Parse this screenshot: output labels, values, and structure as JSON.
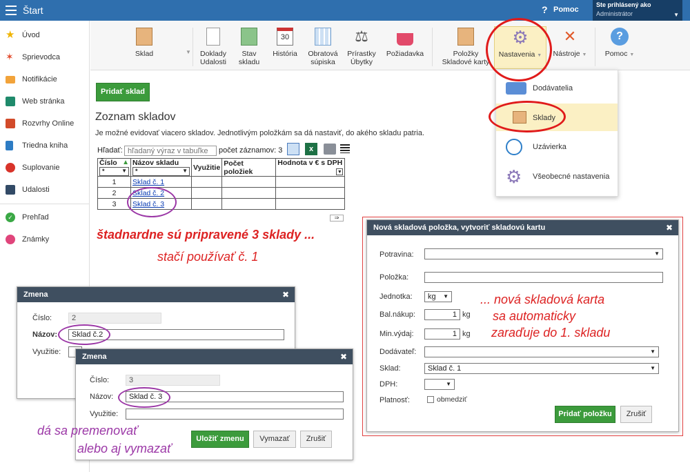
{
  "app": {
    "title": "Štart",
    "help_label": "Pomoc",
    "user_line1": "Ste prihlásený ako",
    "user_line2": "Administrátor"
  },
  "sidebar": {
    "items": [
      {
        "label": "Úvod",
        "icon": "star-icon"
      },
      {
        "label": "Sprievodca",
        "icon": "wand-icon"
      },
      {
        "label": "Notifikácie",
        "icon": "envelope-icon"
      },
      {
        "label": "Web stránka",
        "icon": "home-icon"
      },
      {
        "label": "Rozvrhy Online",
        "icon": "calendar-icon"
      },
      {
        "label": "Triedna kniha",
        "icon": "book-icon"
      },
      {
        "label": "Suplovanie",
        "icon": "person-icon"
      },
      {
        "label": "Udalosti",
        "icon": "board-icon"
      },
      {
        "label": "Prehľad",
        "icon": "check-icon"
      },
      {
        "label": "Známky",
        "icon": "grade-icon"
      }
    ]
  },
  "toolbar": {
    "sklad": "Sklad",
    "doklady_1": "Doklady",
    "doklady_2": "Udalosti",
    "stav_1": "Stav",
    "stav_2": "skladu",
    "historia": "História",
    "historia_num": "30",
    "obratova_1": "Obratová",
    "obratova_2": "súpiska",
    "prirastky_1": "Prírastky",
    "prirastky_2": "Úbytky",
    "poziadavka": "Požiadavka",
    "polozky_1": "Položky",
    "polozky_2": "Skladové karty",
    "nastavenia": "Nastavenia",
    "nastroje": "Nástroje",
    "pomoc": "Pomoc"
  },
  "dropdown": {
    "items": [
      "Dodávatelia",
      "Sklady",
      "Uzávierka",
      "Všeobecné nastavenia"
    ]
  },
  "main": {
    "add_button": "Pridať sklad",
    "heading": "Zoznam skladov",
    "description": "Je možné evidovať viacero skladov. Jednotlivým položkám sa dá nastaviť, do akého skladu patria.",
    "search_label": "Hľadať:",
    "search_placeholder": "hľadaný výraz v tabuľke",
    "count_label": "počet záznamov: 3",
    "table": {
      "headers": [
        "Číslo",
        "Názov skladu",
        "Využitie",
        "Počet položiek",
        "Hodnota v € s DPH"
      ],
      "filter_value": "*",
      "rows": [
        {
          "num": "1",
          "name": "Sklad č. 1"
        },
        {
          "num": "2",
          "name": "Sklad č. 2"
        },
        {
          "num": "3",
          "name": "Sklad č. 3"
        }
      ]
    }
  },
  "dialog1": {
    "title": "Zmena",
    "label_cislo": "Číslo:",
    "cislo": "2",
    "label_nazov": "Názov:",
    "nazov": "Sklad č.2",
    "label_vyuzitie": "Využitie:"
  },
  "dialog2": {
    "title": "Zmena",
    "label_cislo": "Číslo:",
    "cislo": "3",
    "label_nazov": "Názov:",
    "nazov": "Sklad č. 3",
    "label_vyuzitie": "Využitie:",
    "save": "Uložiť zmenu",
    "delete": "Vymazať",
    "cancel": "Zrušiť"
  },
  "dialog3": {
    "title": "Nová skladová položka, vytvoriť skladovú kartu",
    "label_potravina": "Potravina:",
    "label_polozka": "Položka:",
    "label_jednotka": "Jednotka:",
    "jednotka": "kg",
    "label_balnakup": "Bal.nákup:",
    "balnakup": "1",
    "balnakup_unit": "kg",
    "label_minvydaj": "Min.výdaj:",
    "minvydaj": "1",
    "minvydaj_unit": "kg",
    "label_dodavatel": "Dodávateľ:",
    "label_sklad": "Sklad:",
    "sklad": "Sklad č. 1",
    "label_dph": "DPH:",
    "label_platnost": "Platnosť:",
    "obmedzit": "obmedziť",
    "add": "Pridať položku",
    "cancel": "Zrušiť"
  },
  "annotations": {
    "a1": "štadnardne sú pripravené 3 sklady ...",
    "a2": "stačí používať č. 1",
    "a3_1": "... nová skladová karta",
    "a3_2": "sa automaticky",
    "a3_3": "zaraďuje do 1. skladu",
    "a4_1": "dá sa premenovať",
    "a4_2": "alebo aj vymazať"
  },
  "colors": {
    "topbar": "#2f6fae",
    "green": "#3c9b3c",
    "dialog_header": "#3f4f60",
    "annotation_red": "#d22222",
    "annotation_purple": "#9b37a6",
    "highlight": "#fbf0c4"
  }
}
